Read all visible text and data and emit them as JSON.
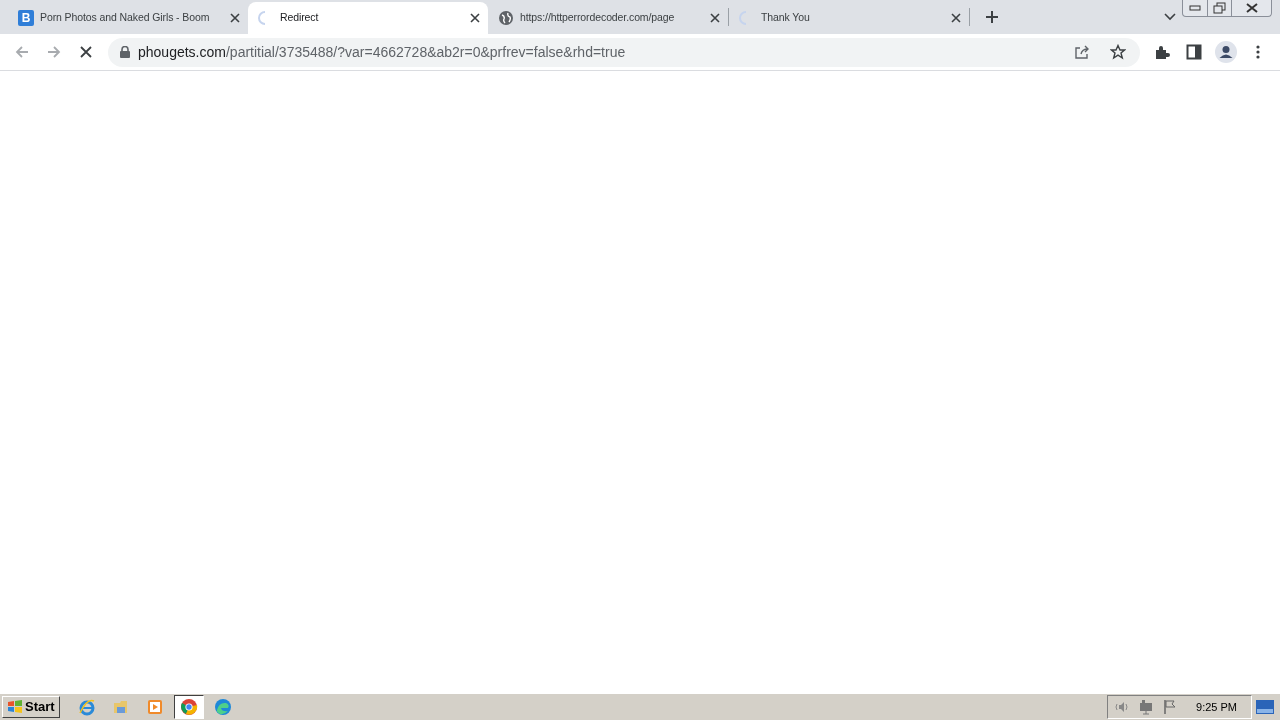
{
  "tabs": [
    {
      "title": "Porn Photos and Naked Girls - Boom",
      "kind": "letter",
      "icon_text": "B",
      "selected": false,
      "loading": false
    },
    {
      "title": "Redirect",
      "kind": "spinner",
      "selected": true,
      "loading": true
    },
    {
      "title": "https://httperrordecoder.com/page",
      "kind": "globe",
      "selected": false,
      "loading": false
    },
    {
      "title": "Thank You",
      "kind": "spinner",
      "selected": false,
      "loading": true
    }
  ],
  "address_bar": {
    "host": "phougets.com",
    "path": "/partitial/3735488/?var=4662728&ab2r=0&prfrev=false&rhd=true",
    "loading": true
  },
  "taskbar": {
    "start_label": "Start",
    "apps": [
      {
        "kind": "ie",
        "selected": false
      },
      {
        "kind": "folder",
        "selected": false
      },
      {
        "kind": "media",
        "selected": false
      },
      {
        "kind": "chrome",
        "selected": true
      },
      {
        "kind": "edge",
        "selected": false
      }
    ],
    "clock": "9:25 PM"
  }
}
